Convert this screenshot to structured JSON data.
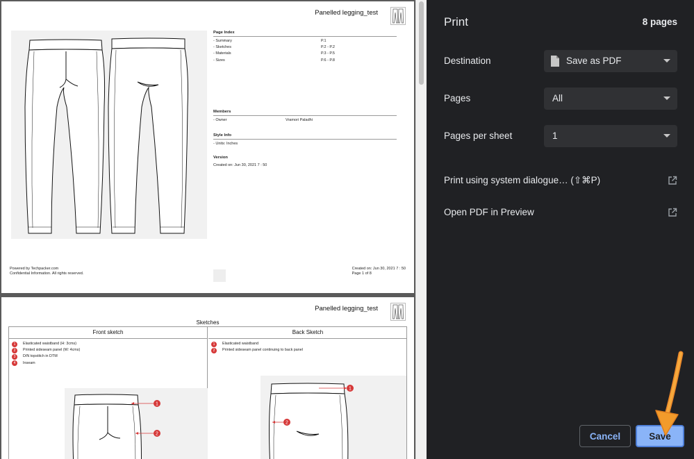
{
  "preview": {
    "page1": {
      "doc_title": "Panelled legging_test",
      "index": {
        "heading": "Page Index",
        "rows": [
          {
            "label": "- Summary",
            "value": "P.1"
          },
          {
            "label": "- Sketches",
            "value": "P.2 - P.2"
          },
          {
            "label": "- Materials",
            "value": "P.3 - P.5"
          },
          {
            "label": "- Sizes",
            "value": "P.6 - P.8"
          }
        ]
      },
      "members": {
        "heading": "Members",
        "rows": [
          {
            "label": "- Owner",
            "value": "Vramori Paladhi"
          }
        ]
      },
      "style_info": {
        "heading": "Style Info",
        "rows": [
          {
            "label": "- Units: Inches"
          }
        ]
      },
      "version": {
        "heading": "Version",
        "created": "Created on: Jun 30, 2021 7 : 50"
      },
      "footer": {
        "powered": "Powered by Techpacker.com",
        "confidential": "Confidential Information. All rights reserved.",
        "created": "Created on: Jun 30, 2021 7 : 50",
        "page_of": "Page 1 of 8"
      }
    },
    "page2": {
      "doc_title": "Panelled legging_test",
      "heading": "Sketches",
      "front": {
        "title": "Front sketch",
        "legend": [
          {
            "num": "1",
            "text": "Elasticated waistband (H: 3cms)"
          },
          {
            "num": "2",
            "text": "Printed sideseam panel (W: 4cms)"
          },
          {
            "num": "3",
            "text": "D/N topstitch in DTM"
          },
          {
            "num": "4",
            "text": "Inseam"
          }
        ],
        "markers": [
          "1",
          "2"
        ]
      },
      "back": {
        "title": "Back Sketch",
        "legend": [
          {
            "num": "1",
            "text": "Elasticated waistband"
          },
          {
            "num": "2",
            "text": "Printed sideseam panel continuing to back panel"
          }
        ],
        "markers": [
          "1",
          "2"
        ]
      }
    }
  },
  "print_panel": {
    "title": "Print",
    "page_count": "8 pages",
    "destination": {
      "label": "Destination",
      "value": "Save as PDF",
      "icon": "document-icon"
    },
    "pages": {
      "label": "Pages",
      "value": "All"
    },
    "pages_per_sheet": {
      "label": "Pages per sheet",
      "value": "1"
    },
    "system_dialog": {
      "label": "Print using system dialogue… (⇧⌘P)",
      "icon": "open-external-icon"
    },
    "open_preview": {
      "label": "Open PDF in Preview",
      "icon": "open-external-icon"
    },
    "cancel_label": "Cancel",
    "save_label": "Save"
  },
  "colors": {
    "panel_bg": "#202124",
    "accent": "#8ab4f8",
    "marker_red": "#d63838",
    "annotation_arrow": "#f29b2b"
  }
}
